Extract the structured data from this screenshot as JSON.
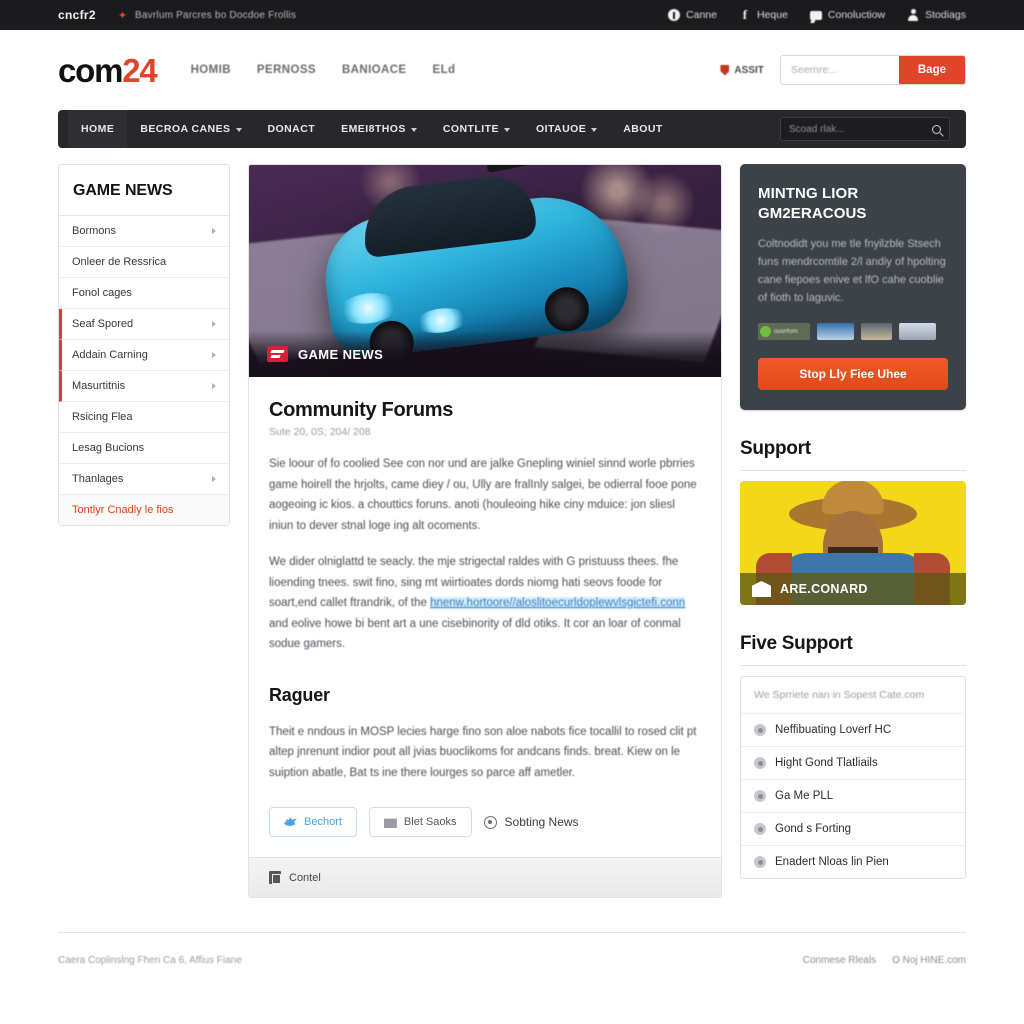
{
  "topbar": {
    "brand": "cncfr2",
    "flash_icon": "lightning-icon",
    "ticker": "Bavrlum Parcres bo Docdoe Frollis",
    "links": [
      {
        "label": "Canne",
        "icon": "info-icon"
      },
      {
        "label": "Heque",
        "icon": "facebook-icon"
      },
      {
        "label": "Conoluctiow",
        "icon": "chat-icon"
      },
      {
        "label": "Stodiags",
        "icon": "user-icon"
      }
    ]
  },
  "header": {
    "logo_first": "com",
    "logo_second": "24",
    "nav": [
      "HOMIB",
      "PERNOSS",
      "BANIOACE",
      "ELd"
    ],
    "assist_label": "ASSIT",
    "search_placeholder": "Seernre:..",
    "search_value": "",
    "search_button": "Bage"
  },
  "mainnav": {
    "items": [
      {
        "label": "HOME",
        "caret": false,
        "active": true
      },
      {
        "label": "BECROA CANES",
        "caret": true,
        "active": false
      },
      {
        "label": "DONACT",
        "caret": false,
        "active": false
      },
      {
        "label": "EMEI8THOS",
        "caret": true,
        "active": false
      },
      {
        "label": "CONTLITE",
        "caret": true,
        "active": false
      },
      {
        "label": "OITAUOE",
        "caret": true,
        "active": false
      },
      {
        "label": "ABOUT",
        "caret": false,
        "active": false
      }
    ],
    "search_placeholder": "Scoad rlak...",
    "search_value": ""
  },
  "sidebar": {
    "title": "GAME NEWS",
    "items": [
      {
        "label": "Bormons",
        "arrow": true,
        "accent": false,
        "highlight": false
      },
      {
        "label": "Onleer de Ressrica",
        "arrow": false,
        "accent": false,
        "highlight": false
      },
      {
        "label": "Fonol cages",
        "arrow": false,
        "accent": false,
        "highlight": false
      },
      {
        "label": "Seaf Spored",
        "arrow": true,
        "accent": true,
        "highlight": false
      },
      {
        "label": "Addain Carning",
        "arrow": true,
        "accent": true,
        "highlight": false
      },
      {
        "label": "Masurtitnis",
        "arrow": true,
        "accent": true,
        "highlight": false
      },
      {
        "label": "Rsicing Flea",
        "arrow": false,
        "accent": false,
        "highlight": false
      },
      {
        "label": "Lesag Bucions",
        "arrow": false,
        "accent": false,
        "highlight": false
      },
      {
        "label": "Thanlages",
        "arrow": true,
        "accent": false,
        "highlight": false
      },
      {
        "label": "Tontlyr Cnadly le fios",
        "arrow": false,
        "accent": false,
        "highlight": true
      }
    ]
  },
  "article": {
    "hero_badge_icon": "news-badge-icon",
    "hero_caption": "GAME NEWS",
    "title": "Community Forums",
    "meta": "Sute 20, 0S; 204/ 208",
    "paragraph1": "Sie loour of fo coolied See con nor und are jalke Gnepling winiel sinnd worle pbrries game hoirell the hrjolts, came diey / ou, Ully are fralInly salgei, be odierral fooe pone aogeoing ic kios. a chouttics foruns. anoti (houleoing hike ciny mduice: jon sliesl iniun to dever stnal loge ing alt ocoments.",
    "paragraph2_pre": "We dider olniglattd te seacly. the mje strigectal raldes with G pristuuss thees. fhe lioending tnees. swit fino, sing mt wiirtioates dords niomg hati seovs foode for soart,end callet ftrandrik, of the ",
    "paragraph2_link": "hnenw.hortoore//aloslitoecurldoplewvlsgictefi.conn",
    "paragraph2_post": " and eolive howe bi bent art a une cisebinority of dld otiks. It cor an loar of conmal sodue gamers.",
    "subheading": "Raguer",
    "paragraph3": "Theit e nndous in MOSP lecies harge fino son aloe nabots fice tocallil to rosed clit pt altep jnrenunt indior pout all jvias buoclikoms for andcans finds. breat. Kiew on le suiption abatle, Bat ts ine there lourges so parce aff ametler.",
    "share_buttons": [
      {
        "label": "Bechort",
        "icon": "twitter-icon",
        "variant": "twitter"
      },
      {
        "label": "Blet Saoks",
        "icon": "calendar-icon",
        "variant": "plain"
      }
    ],
    "share_link": {
      "label": "Sobting News",
      "icon": "record-icon"
    },
    "footer_label": "Contel",
    "footer_icon": "image-icon"
  },
  "promo": {
    "heading_line1": "MINTNG LIOR",
    "heading_line2": "GM2ERACOUS",
    "body": "Coltnodidt you me tle fnyilzble Stsech funs mendrcomtile 2/l andiy of hpolting cane fiepoes enive et lfO cahe cuoblie of fioth to laguvic.",
    "badges": [
      {
        "name": "checkmark-badge",
        "label": "ouvrfom"
      },
      {
        "name": "image-badge-2",
        "label": ""
      },
      {
        "name": "image-badge-3",
        "label": ""
      },
      {
        "name": "image-badge-4",
        "label": ""
      }
    ],
    "cta_label": "Stop Lly Fiee Uhee",
    "accent_color": "#e04a1a",
    "background_color": "#3d4249"
  },
  "support": {
    "heading": "Support",
    "card_caption": "ARE.CONARD",
    "card_icon": "bank-icon",
    "card_bg_color": "#f2d818"
  },
  "five_support": {
    "heading": "Five Support",
    "note": "We Sprriete nan in Sopest Cate.com",
    "items": [
      {
        "label": "Neffibuating Loverf HC",
        "icon": "gear-icon"
      },
      {
        "label": "Hight Gond Tlatliails",
        "icon": "record-icon"
      },
      {
        "label": "Ga Me PLL",
        "icon": "record-icon"
      },
      {
        "label": "Gond s Forting",
        "icon": "record-icon"
      },
      {
        "label": "Enadert Nloas lin Pien",
        "icon": "record-icon"
      }
    ]
  },
  "footer": {
    "copyright": "Caera Coplinslng Fhen Ca 6, Affius Fiane",
    "links": [
      "Conmese Rleals",
      "O Noj HINE.com"
    ]
  }
}
